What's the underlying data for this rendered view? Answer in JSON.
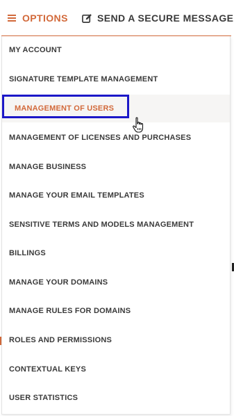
{
  "header": {
    "options_label": "OPTIONS",
    "send_label": "SEND A SECURE MESSAGE",
    "options_icon": "hamburger-menu-icon",
    "send_icon": "edit-icon"
  },
  "menu": {
    "items": [
      {
        "label": "MY ACCOUNT"
      },
      {
        "label": "SIGNATURE TEMPLATE MANAGEMENT"
      },
      {
        "label": "MANAGEMENT OF USERS"
      },
      {
        "label": "MANAGEMENT OF LICENSES AND PURCHASES"
      },
      {
        "label": "MANAGE BUSINESS"
      },
      {
        "label": "MANAGE YOUR EMAIL TEMPLATES"
      },
      {
        "label": "SENSITIVE TERMS AND MODELS MANAGEMENT"
      },
      {
        "label": "BILLINGS"
      },
      {
        "label": "MANAGE YOUR DOMAINS"
      },
      {
        "label": "MANAGE RULES FOR DOMAINS"
      },
      {
        "label": "ROLES AND PERMISSIONS"
      },
      {
        "label": "CONTEXTUAL KEYS"
      },
      {
        "label": "USER STATISTICS"
      }
    ],
    "active_index": 2
  },
  "colors": {
    "accent": "#d2693a",
    "text": "#3a3a3a",
    "highlight_box": "#1c18c8",
    "active_bg": "#f6f5f4"
  }
}
